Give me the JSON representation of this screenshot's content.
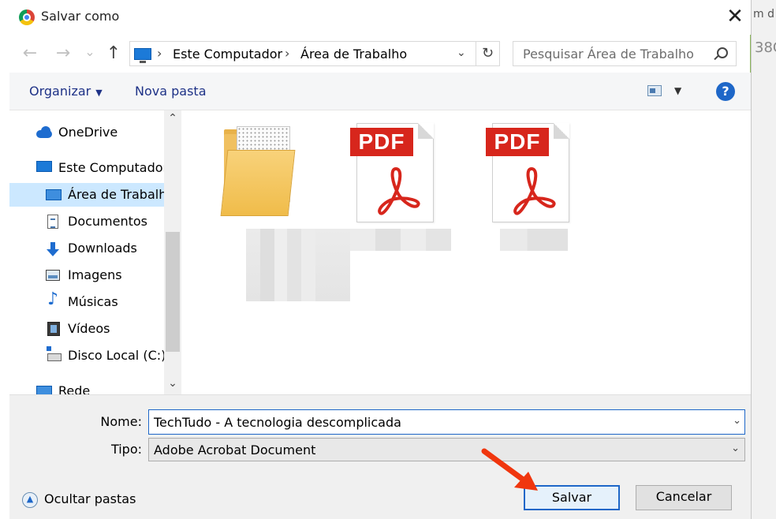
{
  "background": {
    "partial_text_top": "m d",
    "partial_text_mid": "38C"
  },
  "dialog": {
    "title": "Salvar como",
    "close_symbol": "✕"
  },
  "nav": {
    "back_symbol": "←",
    "forward_symbol": "→",
    "recent_symbol": "⌄",
    "up_symbol": "↑",
    "breadcrumb": [
      "Este Computador",
      "Área de Trabalho"
    ],
    "crumb_sep": "›",
    "dropdown_symbol": "⌄",
    "refresh_symbol": "↻",
    "search_placeholder": "Pesquisar Área de Trabalho"
  },
  "toolbar": {
    "organize_label": "Organizar",
    "organize_caret": "▼",
    "new_folder_label": "Nova pasta",
    "view_caret": "▼",
    "help_label": "?"
  },
  "sidebar": {
    "items": [
      {
        "label": "OneDrive",
        "icon": "cloud-icon"
      },
      {
        "label": "Este Computador",
        "icon": "computer-icon"
      },
      {
        "label": "Área de Trabalho",
        "icon": "desktop-icon",
        "selected": true
      },
      {
        "label": "Documentos",
        "icon": "documents-icon"
      },
      {
        "label": "Downloads",
        "icon": "download-icon"
      },
      {
        "label": "Imagens",
        "icon": "pictures-icon"
      },
      {
        "label": "Músicas",
        "icon": "music-icon"
      },
      {
        "label": "Vídeos",
        "icon": "video-icon"
      },
      {
        "label": "Disco Local (C:)",
        "icon": "disk-icon"
      },
      {
        "label": "Rede",
        "icon": "network-icon"
      }
    ],
    "scroll_up": "⌃",
    "scroll_down": "⌄",
    "music_glyph": "♪"
  },
  "files": [
    {
      "type": "folder"
    },
    {
      "type": "pdf",
      "badge": "PDF"
    },
    {
      "type": "pdf",
      "badge": "PDF"
    }
  ],
  "form": {
    "name_label": "Nome:",
    "name_value": "TechTudo - A tecnologia descomplicada",
    "type_label": "Tipo:",
    "type_value": "Adobe Acrobat Document",
    "dropdown_symbol": "⌄",
    "hide_folders_label": "Ocultar pastas",
    "hide_folders_symbol": "▲",
    "save_label": "Salvar",
    "cancel_label": "Cancelar"
  },
  "colors": {
    "accent": "#1e67c8",
    "annotation_arrow": "#f0360e",
    "pdf_red": "#d7261c"
  }
}
